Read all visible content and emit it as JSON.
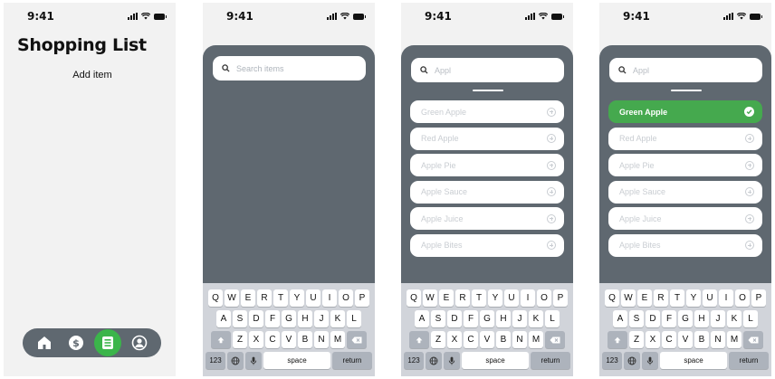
{
  "status": {
    "time": "9:41"
  },
  "screen1": {
    "title": "Shopping List",
    "add_item": "Add item",
    "nav": [
      {
        "name": "home-icon"
      },
      {
        "name": "dollar-icon"
      },
      {
        "name": "list-icon",
        "active": true
      },
      {
        "name": "profile-icon"
      }
    ]
  },
  "screen2": {
    "search_placeholder": "Search items"
  },
  "screen3": {
    "search_value": "Appl",
    "items": [
      "Green Apple",
      "Red Apple",
      "Apple Pie",
      "Apple Sauce",
      "Apple Juice",
      "Apple Bites"
    ]
  },
  "screen4": {
    "search_value": "Appl",
    "selected": "Green Apple",
    "items": [
      "Green Apple",
      "Red Apple",
      "Apple Pie",
      "Apple Sauce",
      "Apple Juice",
      "Apple Bites"
    ]
  },
  "keyboard": {
    "row1": [
      "Q",
      "W",
      "E",
      "R",
      "T",
      "Y",
      "U",
      "I",
      "O",
      "P"
    ],
    "row2": [
      "A",
      "S",
      "D",
      "F",
      "G",
      "H",
      "J",
      "K",
      "L"
    ],
    "row3": [
      "Z",
      "X",
      "C",
      "V",
      "B",
      "N",
      "M"
    ],
    "num_label": "123",
    "space_label": "space",
    "return_label": "return"
  },
  "colors": {
    "accent_green": "#45a94e",
    "sheet": "#5f6870",
    "keyboard": "#d1d4da"
  }
}
